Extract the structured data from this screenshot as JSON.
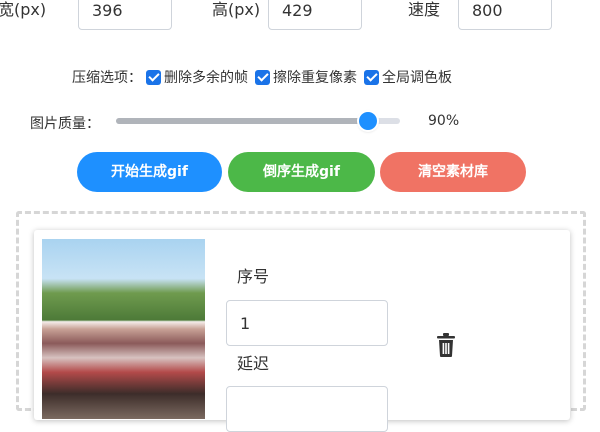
{
  "size_row": {
    "width_label": "宽(px)",
    "width_value": "396",
    "height_label": "高(px)",
    "height_value": "429",
    "speed_label": "速度",
    "speed_value": "800"
  },
  "compress": {
    "label": "压缩选项：",
    "options": [
      {
        "label": "删除多余的帧",
        "checked": true
      },
      {
        "label": "擦除重复像素",
        "checked": true
      },
      {
        "label": "全局调色板",
        "checked": true
      }
    ]
  },
  "quality": {
    "label": "图片质量：",
    "value": 0.9,
    "value_text": "90%"
  },
  "buttons": {
    "start": "开始生成gif",
    "reverse": "倒序生成gif",
    "clear": "清空素材库"
  },
  "colors": {
    "start": "#1e90ff",
    "reverse": "#4cb848",
    "clear": "#f07364"
  },
  "item": {
    "index_label": "序号",
    "index_value": "1",
    "delay_label": "延迟",
    "delete_icon": "trash-icon"
  }
}
